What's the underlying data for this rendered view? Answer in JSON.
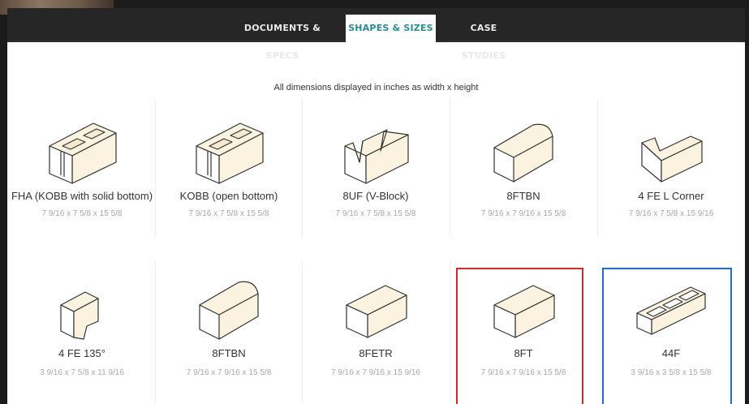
{
  "tabs": [
    {
      "label": "DOCUMENTS & SPECS"
    },
    {
      "label": "SHAPES & SIZES",
      "active": true
    },
    {
      "label": "CASE STUDIES"
    }
  ],
  "subtitle": "All dimensions displayed in inches as width x height",
  "products": [
    {
      "name": "FHA (KOBB with solid bottom)",
      "dims": "7 9/16 x 7 5/8 x 15 5/8",
      "icon": "cmu-two-core-icon"
    },
    {
      "name": "KOBB (open bottom)",
      "dims": "7 9/16 x 7 5/8 x 15 5/8",
      "icon": "cmu-two-core-icon"
    },
    {
      "name": "8UF (V-Block)",
      "dims": "7 9/16 x 7 5/8 x 15 5/8",
      "icon": "v-block-icon"
    },
    {
      "name": "8FTBN",
      "dims": "7 9/16 x 7 9/16 x 15 5/8",
      "icon": "bullnose-block-icon"
    },
    {
      "name": "4 FE L Corner",
      "dims": "7 9/16 x 7 5/8 x 15 9/16",
      "icon": "l-corner-icon"
    },
    {
      "name": "4 FE 135°",
      "dims": "3 9/16 x 7 5/8 x 11 9/16",
      "icon": "angle-135-icon"
    },
    {
      "name": "8FTBN",
      "dims": "7 9/16 x 7 9/16 x 15 5/8",
      "icon": "bullnose-block-icon"
    },
    {
      "name": "8FETR",
      "dims": "7 9/16 x 7 9/16 x 15 9/16",
      "icon": "solid-block-icon"
    },
    {
      "name": "8FT",
      "dims": "7 9/16 x 7 9/16 x 15 5/8",
      "icon": "solid-block-icon"
    },
    {
      "name": "44F",
      "dims": "3 9/16 x 3 5/8 x 15 5/8",
      "icon": "three-core-block-icon"
    }
  ],
  "colors": {
    "tabbar": "#262626",
    "active_tab_text": "#2b8a8f",
    "block_fill": "#fbf3df",
    "highlight_red": "#d22b2b",
    "highlight_blue": "#1f6fc6"
  }
}
